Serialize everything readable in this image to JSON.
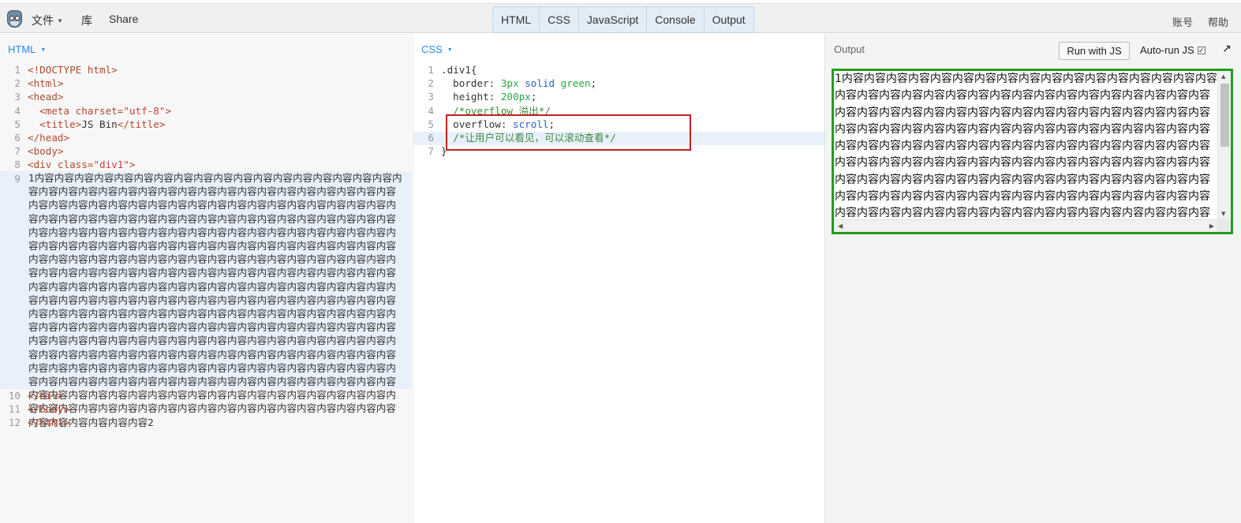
{
  "menu": {
    "file": "文件",
    "library": "库",
    "share": "Share"
  },
  "tabs": [
    "HTML",
    "CSS",
    "JavaScript",
    "Console",
    "Output"
  ],
  "header_right": {
    "account": "账号",
    "help": "帮助"
  },
  "html_panel": {
    "label": "HTML",
    "lines": [
      {
        "n": "1"
      },
      {
        "n": "2"
      },
      {
        "n": "3"
      },
      {
        "n": "4"
      },
      {
        "n": "5"
      },
      {
        "n": "6"
      },
      {
        "n": "7"
      },
      {
        "n": "8"
      },
      {
        "n": "9"
      },
      {
        "n": "10"
      },
      {
        "n": "11"
      },
      {
        "n": "12"
      }
    ],
    "doctype": "<!DOCTYPE html>",
    "html_open": "<html>",
    "head_open": "<head>",
    "meta_tag": "<meta charset=",
    "meta_value": "\"utf-8\"",
    "meta_close": ">",
    "title_open": "<title>",
    "title_text": "JS Bin",
    "title_close": "</title>",
    "head_close": "</head>",
    "body_open": "<body>",
    "div_open": "<div class=",
    "div_class": "\"div1\"",
    "div_open_close": ">",
    "div_content": "1内容内容内容内容内容内容内容内容内容内容内容内容内容内容内容内容内容内容内容内容内容内容内容内容内容内容内容内容内容内容内容内容内容内容内容内容内容内容内容内容内容内容内容内容内容内容内容内容内容内容内容内容内容内容内容内容内容内容内容内容内容内容内容内容内容内容内容内容内容内容内容内容内容内容内容内容内容内容内容内容内容内容内容内容内容内容内容内容内容内容内容内容内容内容内容内容内容内容内容内容内容内容内容内容内容内容内容内容内容内容内容内容内容内容内容内容内容内容内容内容内容内容内容内容内容内容内容内容内容内容内容内容内容内容内容内容内容内容内容内容内容内容内容内容内容内容内容内容内容内容内容内容内容内容内容内容内容内容内容内容内容内容内容内容内容内容内容内容内容内容内容内容内容内容内容内容内容内容内容内容内容内容内容内容内容内容内容内容内容内容内容内容内容内容内容内容内容内容内容内容内容内容内容内容内容内容内容内容内容内容内容内容内容内容内容内容内容内容内容内容内容内容内容内容内容内容内容内容内容内容内容内容内容内容内容内容内容内容内容内容内容内容内容内容内容内容内容内容内容内容内容内容内容内容内容内容内容内容内容内容内容内容内容内容内容内容内容内容内容内容内容内容内容内容内容内容内容内容内容内容内容内容内容内容内容内容内容内容内容内容内容内容内容内容内容内容内容内容内容内容内容内容内容内容内容内容内容内容内容内容内容内容内容内容内容内容内容内容内容内容内容内容内容内容内容内容内容内容内容内容内容内容内容内容内容内容内容内容内容2",
    "div_close": "</div>",
    "body_close": "</body>",
    "html_close": "</html>"
  },
  "css_panel": {
    "label": "CSS",
    "selector": ".div1{",
    "border_prop": "border: ",
    "border_val_num": "3px",
    "border_val_rest": " solid ",
    "border_val_color": "green",
    "border_semi": ";",
    "height_prop": "height: ",
    "height_val": "200px",
    "height_semi": ";",
    "comment1": "/*overflow 溢出*/",
    "overflow_prop": "overflow: ",
    "overflow_val": "scroll",
    "overflow_semi": ";",
    "comment2": "/*让用户可以看见，可以滚动查看*/",
    "close_brace": "}"
  },
  "output_panel": {
    "label": "Output",
    "run_button": "Run with JS",
    "autorun_label": "Auto-run JS",
    "autorun_checked": true,
    "popout_icon": "↗",
    "div1_text": "1内容内容内容内容内容内容内容内容内容内容内容内容内容内容内容内容内容内容内容内容内容内容内容内容内容内容内容内容内容内容内容内容内容内容内容内容内容内容内容内容内容内容内容内容内容内容内容内容内容内容内容内容内容内容内容内容内容内容内容内容内容内容内容内容内容内容内容内容内容内容内容内容内容内容内容内容内容内容内容内容内容内容内容内容内容内容内容内容内容内容内容内容内容内容内容内容内容内容内容内容内容内容内容内容内容内容内容内容内容内容内容内容内容内容内容内容内容内容内容内容内容内容内容内容内容内容内容内容内容内容内容内容内容内容内容内容内容内容内容内容内容内容内容内容内容内容内容内容内容内容内容内容内容内容内容内容内容内容内容内容"
  },
  "colors": {
    "accent": "#2c8be6",
    "div1_border": "#1e9e1e",
    "highlight_box": "#c81e1e"
  }
}
